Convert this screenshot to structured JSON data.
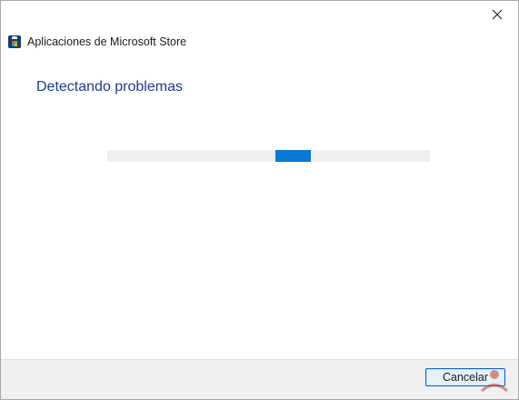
{
  "window": {
    "title": "Aplicaciones de Microsoft Store",
    "app_icon": "microsoft-store-icon",
    "close_icon": "close-icon"
  },
  "main": {
    "heading": "Detectando problemas",
    "progress": {
      "mode": "indeterminate",
      "chunk_start_fraction": 0.52,
      "chunk_width_fraction": 0.11,
      "track_color": "#efefef",
      "fill_color": "#0a78d4"
    }
  },
  "footer": {
    "cancel_label": "Cancelar"
  },
  "colors": {
    "heading": "#1d3b8f",
    "accent": "#0a78d4",
    "footer_bg": "#f0f0f0"
  }
}
